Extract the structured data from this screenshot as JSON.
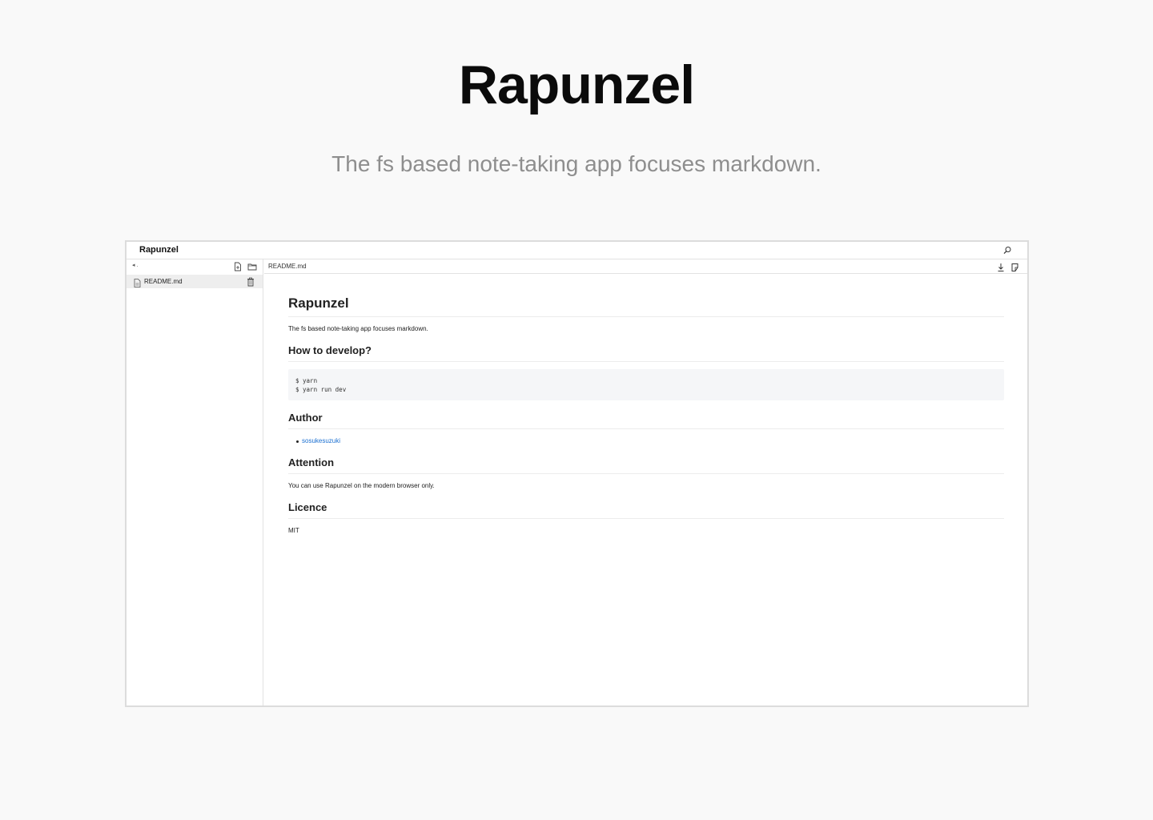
{
  "hero": {
    "title": "Rapunzel",
    "subtitle": "The fs based note-taking app focuses markdown."
  },
  "app": {
    "title": "Rapunzel",
    "search_icon": "search-icon",
    "sidebar": {
      "dir_indicator": "◂ .",
      "new_file_icon": "new-file-icon",
      "new_folder_icon": "new-folder-icon",
      "files": [
        {
          "name": "README.md",
          "icon": "file-icon",
          "action_icon": "trash-icon"
        }
      ]
    },
    "editor": {
      "filename": "README.md",
      "download_icon": "download-icon",
      "edit_icon": "edit-icon"
    },
    "preview": {
      "h1": "Rapunzel",
      "intro": "The fs based note-taking app focuses markdown.",
      "develop_heading": "How to develop?",
      "code_lines": [
        "$ yarn",
        "$ yarn run dev"
      ],
      "author_heading": "Author",
      "author_link": "sosukesuzuki",
      "attention_heading": "Attention",
      "attention_text": "You can use Rapunzel on the modern browser only.",
      "licence_heading": "Licence",
      "licence_text": "MIT"
    }
  },
  "colors": {
    "background": "#f9f9f9",
    "link": "#1a6fd1",
    "selected_row": "#eeeeee",
    "code_bg": "#f5f6f8"
  }
}
